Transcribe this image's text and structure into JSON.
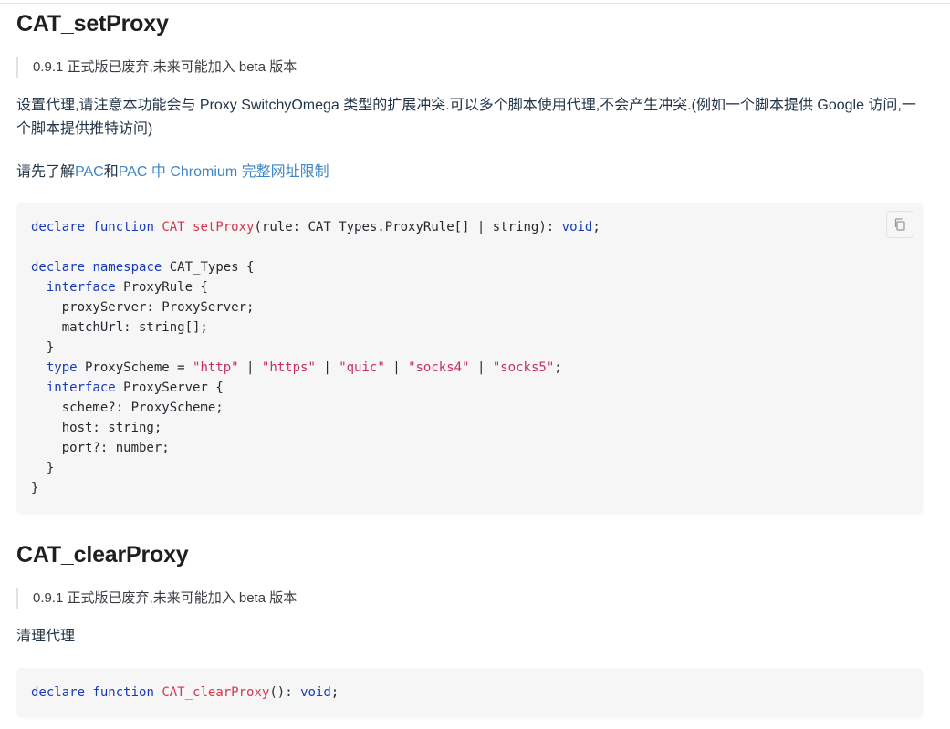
{
  "sections": [
    {
      "title": "CAT_setProxy",
      "note": "0.9.1 正式版已废弃,未来可能加入 beta 版本",
      "description": "设置代理,请注意本功能会与 Proxy SwitchyOmega 类型的扩展冲突.可以多个脚本使用代理,不会产生冲突.(例如一个脚本提供 Google 访问,一个脚本提供推特访问)",
      "read_prefix": "请先了解",
      "link_pac": "PAC",
      "read_and": "和",
      "link_pac_chromium": "PAC 中 Chromium 完整网址限制",
      "code": {
        "declare": "declare",
        "function": "function",
        "fn_name": "CAT_setProxy",
        "signature": "(rule: CAT_Types.ProxyRule[] | string): ",
        "void": "void",
        "semi": ";",
        "namespace_kw": "namespace",
        "namespace_name": " CAT_Types {",
        "interface_kw": "interface",
        "proxy_rule": " ProxyRule {",
        "proxy_server_field": "proxyServer: ProxyServer;",
        "match_url_field": "matchUrl: string[];",
        "close_brace": "}",
        "type_kw": "type",
        "proxy_scheme_decl": " ProxyScheme = ",
        "scheme_http": "\"http\"",
        "scheme_https": "\"https\"",
        "scheme_quic": "\"quic\"",
        "scheme_socks4": "\"socks4\"",
        "scheme_socks5": "\"socks5\"",
        "pipe": " | ",
        "proxy_server_iface": " ProxyServer {",
        "scheme_field": "scheme?: ProxyScheme;",
        "host_field": "host: string;",
        "port_field": "port?: number;"
      }
    },
    {
      "title": "CAT_clearProxy",
      "note": "0.9.1 正式版已废弃,未来可能加入 beta 版本",
      "description": "清理代理",
      "code": {
        "declare": "declare",
        "function": "function",
        "fn_name": "CAT_clearProxy",
        "signature": "(): ",
        "void": "void",
        "semi": ";"
      }
    }
  ],
  "icons": {
    "copy": "copy-icon"
  }
}
